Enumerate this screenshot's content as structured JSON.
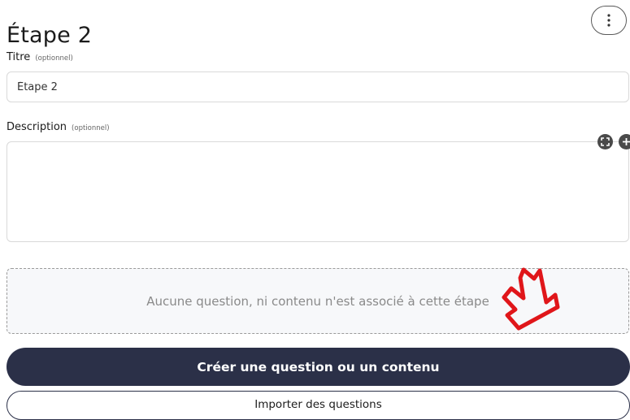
{
  "step": {
    "title": "Étape 2"
  },
  "fields": {
    "title_label": "Titre",
    "title_optional": "(optionnel)",
    "title_value": "Étape 2",
    "description_label": "Description",
    "description_optional": "(optionnel)",
    "description_value": ""
  },
  "empty_state": {
    "message": "Aucune question, ni contenu n'est associé à cette étape"
  },
  "actions": {
    "create_label": "Créer une question ou un contenu",
    "import_label": "Importer des questions"
  },
  "icons": {
    "more": "more-vertical-icon",
    "fullscreen": "fullscreen-icon",
    "add": "plus-circle-icon",
    "annotation": "red-arrow-annotation"
  },
  "colors": {
    "primary": "#2b3048",
    "annotation": "#e0161a",
    "border": "#d9d9d9"
  }
}
